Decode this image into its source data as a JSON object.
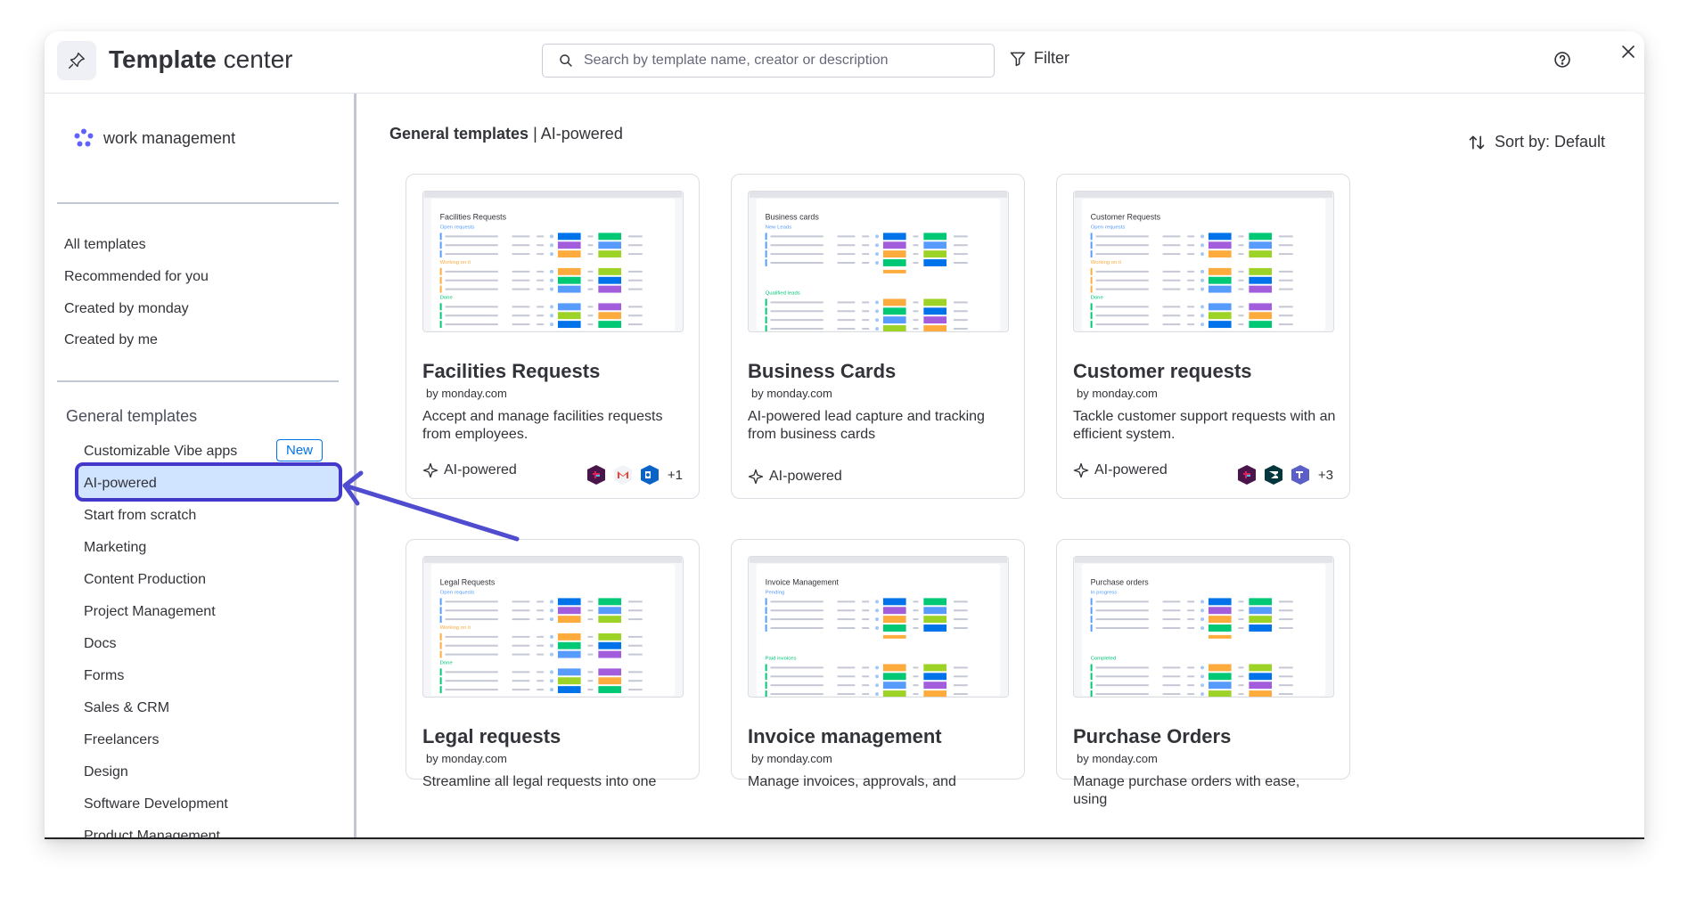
{
  "header": {
    "title_bold": "Template",
    "title_rest": " center",
    "search_placeholder": "Search by template name, creator or description",
    "filter_label": "Filter"
  },
  "sidebar": {
    "workspace": "work management",
    "nav": [
      "All templates",
      "Recommended for you",
      "Created by monday",
      "Created by me"
    ],
    "section_title": "General templates",
    "items": [
      "Customizable Vibe apps",
      "AI-powered",
      "Start from scratch",
      "Marketing",
      "Content Production",
      "Project Management",
      "Docs",
      "Forms",
      "Sales & CRM",
      "Freelancers",
      "Design",
      "Software Development",
      "Product Management"
    ],
    "new_badge": "New",
    "selected": "AI-powered"
  },
  "main": {
    "crumb_bold": "General templates",
    "crumb_rest": "| AI-powered",
    "sort_label": "Sort by: Default"
  },
  "cards": [
    {
      "title": "Facilities Requests",
      "by": "by monday.com",
      "desc": "Accept and manage facilities requests from employees.",
      "tag": "AI-powered",
      "integrations": [
        "slack-icon",
        "gmail-icon",
        "outlook-icon"
      ],
      "more": "+1",
      "thumb": {
        "title": "Facilities Requests",
        "groups": [
          {
            "label": "Open requests",
            "color": "#579bfc"
          },
          {
            "label": "Working on it",
            "color": "#fdab3d"
          },
          {
            "label": "Done",
            "color": "#00c875"
          }
        ]
      }
    },
    {
      "title": "Business Cards",
      "by": "by monday.com",
      "desc": "AI-powered lead capture and tracking from business cards",
      "tag": "AI-powered",
      "integrations": [],
      "more": "",
      "thumb": {
        "title": "Business cards",
        "groups": [
          {
            "label": "New Leads",
            "color": "#579bfc"
          },
          {
            "label": "Qualified leads",
            "color": "#00c875"
          }
        ]
      }
    },
    {
      "title": "Customer requests",
      "by": "by monday.com",
      "desc": "Tackle customer support requests with an efficient system.",
      "tag": "AI-powered",
      "integrations": [
        "slack-icon",
        "zendesk-icon",
        "teams-icon"
      ],
      "more": "+3",
      "thumb": {
        "title": "Customer Requests",
        "groups": [
          {
            "label": "Open requests",
            "color": "#579bfc"
          },
          {
            "label": "Working on it",
            "color": "#fdab3d"
          },
          {
            "label": "Done",
            "color": "#00c875"
          }
        ]
      }
    },
    {
      "title": "Legal requests",
      "by": "by monday.com",
      "desc": "Streamline all legal requests into one",
      "tag": "",
      "integrations": [],
      "more": "",
      "thumb": {
        "title": "Legal Requests",
        "groups": [
          {
            "label": "Open requests",
            "color": "#579bfc"
          },
          {
            "label": "Working on it",
            "color": "#fdab3d"
          },
          {
            "label": "Done",
            "color": "#00c875"
          }
        ]
      }
    },
    {
      "title": "Invoice management",
      "by": "by monday.com",
      "desc": "Manage invoices, approvals, and",
      "tag": "",
      "integrations": [],
      "more": "",
      "thumb": {
        "title": "Invoice Management",
        "groups": [
          {
            "label": "Pending",
            "color": "#579bfc"
          },
          {
            "label": "Paid invoices",
            "color": "#00c875"
          }
        ]
      }
    },
    {
      "title": "Purchase Orders",
      "by": "by monday.com",
      "desc": "Manage purchase orders with ease, using",
      "tag": "",
      "integrations": [],
      "more": "",
      "thumb": {
        "title": "Purchase orders",
        "groups": [
          {
            "label": "In progress",
            "color": "#579bfc"
          },
          {
            "label": "Completed",
            "color": "#00c875"
          }
        ]
      }
    }
  ]
}
